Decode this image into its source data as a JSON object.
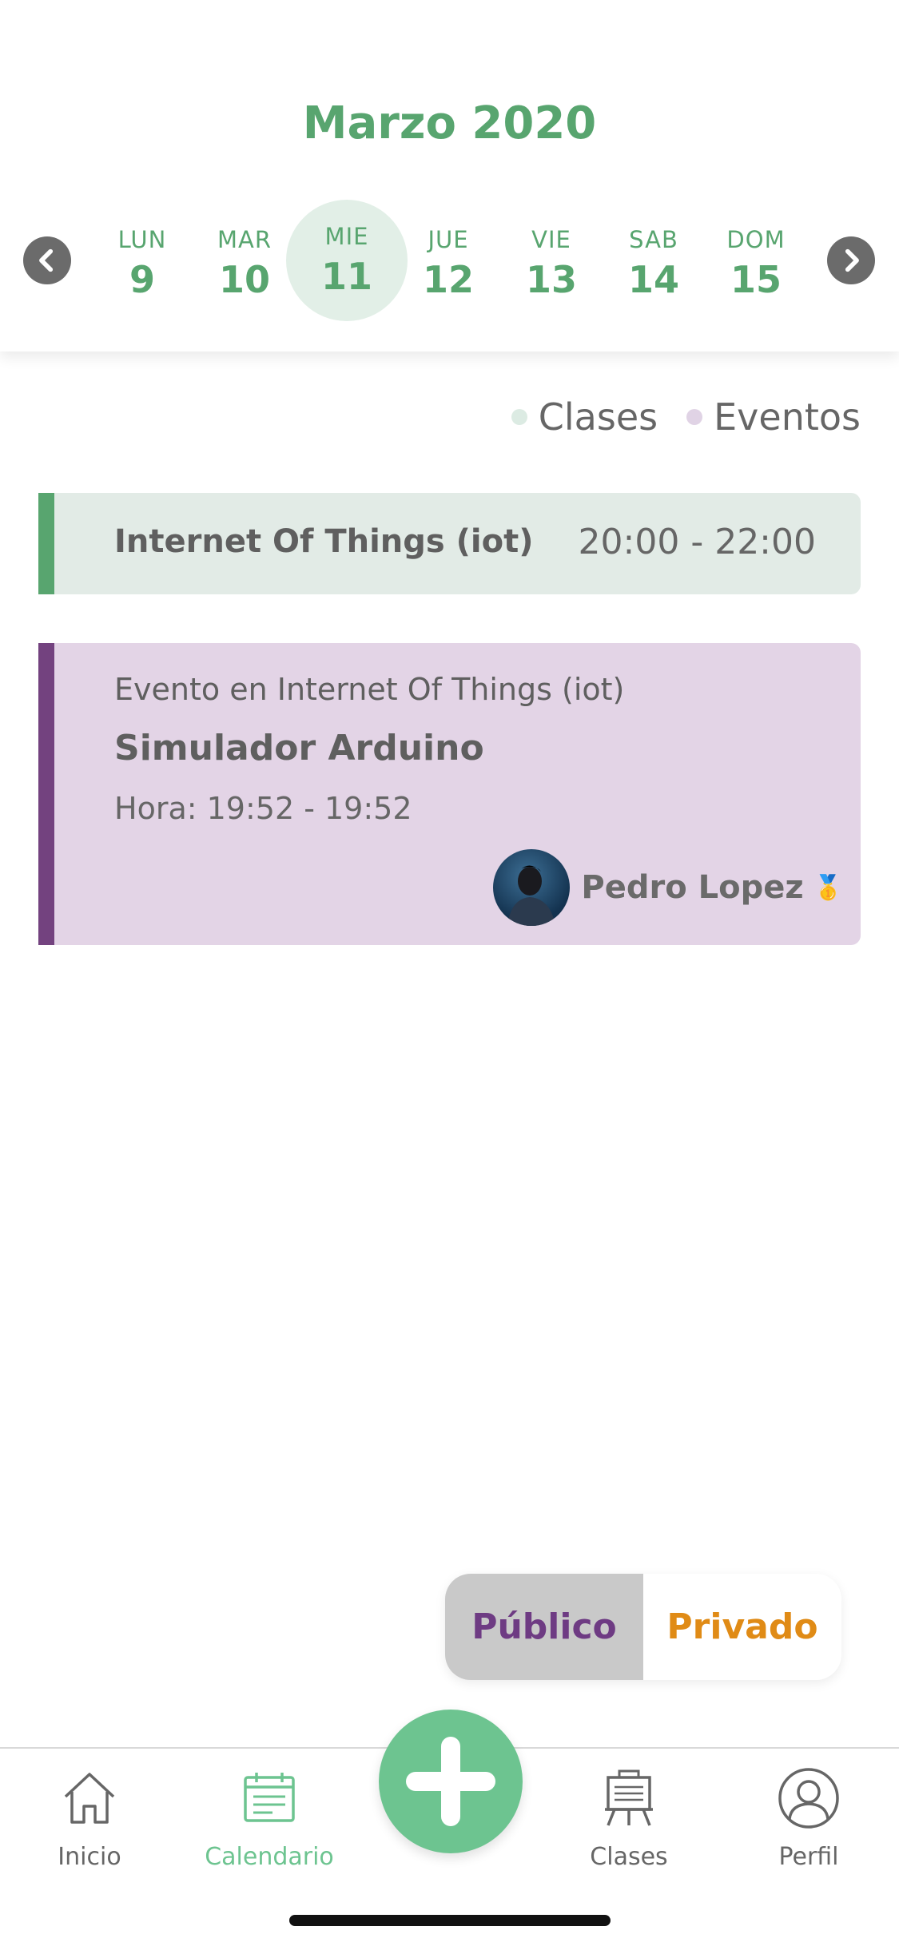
{
  "header": {
    "month": "Marzo 2020",
    "days": [
      {
        "dow": "LUN",
        "num": "9"
      },
      {
        "dow": "MAR",
        "num": "10"
      },
      {
        "dow": "MIE",
        "num": "11",
        "selected": true
      },
      {
        "dow": "JUE",
        "num": "12"
      },
      {
        "dow": "VIE",
        "num": "13"
      },
      {
        "dow": "SAB",
        "num": "14"
      },
      {
        "dow": "DOM",
        "num": "15"
      }
    ]
  },
  "legend": {
    "classes_label": "Clases",
    "classes_color": "#dcebe3",
    "events_label": "Eventos",
    "events_color": "#e0d3e5"
  },
  "class_card": {
    "name": "Internet Of Things (iot)",
    "time": "20:00 - 22:00"
  },
  "event_card": {
    "subtitle": "Evento en Internet Of Things (iot)",
    "title": "Simulador Arduino",
    "hour": "Hora: 19:52 - 19:52",
    "user": "Pedro Lopez",
    "badge": "🥇"
  },
  "visibility_toggle": {
    "public_label": "Público",
    "private_label": "Privado",
    "selected": "Público"
  },
  "tabbar": {
    "tabs": [
      {
        "label": "Inicio",
        "icon": "home-icon"
      },
      {
        "label": "Calendario",
        "icon": "calendar-icon",
        "active": true
      },
      {
        "label": "Clases",
        "icon": "easel-icon"
      },
      {
        "label": "Perfil",
        "icon": "profile-icon"
      }
    ],
    "fab_icon": "plus-icon"
  },
  "colors": {
    "green": "#58a56f",
    "tab_active": "#6dc490",
    "purple": "#73427f",
    "orange": "#e08b16"
  }
}
